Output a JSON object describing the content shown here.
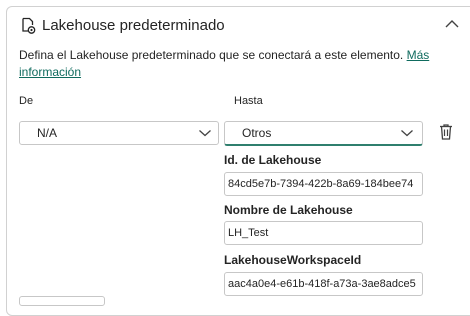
{
  "header": {
    "title": "Lakehouse predeterminado",
    "lakehouse_icon": "lakehouse-settings-icon",
    "collapse_icon": "chevron-up-icon"
  },
  "description": {
    "text": "Defina el Lakehouse predeterminado que se conectará a este elemento. ",
    "link_text": "Más información"
  },
  "from": {
    "label": "De",
    "value": "N/A",
    "chevron_icon": "chevron-down-icon"
  },
  "to": {
    "label": "Hasta",
    "value": "Otros",
    "chevron_icon": "chevron-down-icon"
  },
  "delete_icon": "trash-icon",
  "fields": {
    "lakehouse_id": {
      "label": "Id. de Lakehouse",
      "value": "84cd5e7b-7394-422b-8a69-184bee74"
    },
    "lakehouse_name": {
      "label": "Nombre de Lakehouse",
      "value": "LH_Test"
    },
    "workspace_id": {
      "label": "LakehouseWorkspaceId",
      "value": "aac4a0e4-e61b-418f-a73a-3ae8adce5"
    }
  },
  "colors": {
    "accent": "#2f7f6e",
    "link": "#0f6b5e",
    "border": "#c7c7c7",
    "text": "#242424"
  }
}
